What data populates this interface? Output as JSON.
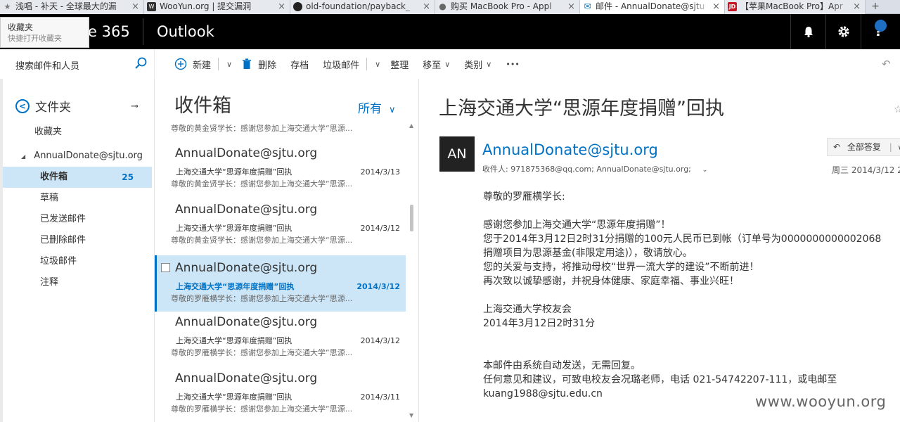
{
  "browser": {
    "tabs": [
      {
        "title": "浅唱 - 补天 - 全球最大的漏",
        "icon": "star-icon",
        "active": false
      },
      {
        "title": "WooYun.org | 提交漏洞",
        "icon": "wooyun-icon",
        "active": false
      },
      {
        "title": "old-foundation/payback_",
        "icon": "github-icon",
        "active": false
      },
      {
        "title": "购买 MacBook Pro - Appl",
        "icon": "apple-icon",
        "active": false
      },
      {
        "title": "邮件 - AnnualDonate@sjtu",
        "icon": "mail-icon",
        "active": true
      },
      {
        "title": "【苹果MacBook Pro】Apr",
        "icon": "jd-icon",
        "active": false
      }
    ],
    "jd_badge": "JD"
  },
  "favorites_popup": {
    "title": "收藏夹",
    "subtitle": "快捷打开收藏夹"
  },
  "suite": {
    "brand": "e 365",
    "app": "Outlook"
  },
  "search": {
    "placeholder": "搜索邮件和人员"
  },
  "commands": {
    "new": "新建",
    "delete": "删除",
    "archive": "存档",
    "junk": "垃圾邮件",
    "sweep": "整理",
    "move": "移至",
    "categories": "类别",
    "more": "•••"
  },
  "folders": {
    "header": "文件夹",
    "favorites": "收藏夹",
    "account": "AnnualDonate@sjtu.org",
    "items": [
      {
        "label": "收件箱",
        "count": "25",
        "selected": true
      },
      {
        "label": "草稿",
        "count": "",
        "selected": false
      },
      {
        "label": "已发送邮件",
        "count": "",
        "selected": false
      },
      {
        "label": "已删除邮件",
        "count": "",
        "selected": false
      },
      {
        "label": "垃圾邮件",
        "count": "",
        "selected": false
      },
      {
        "label": "注释",
        "count": "",
        "selected": false
      }
    ]
  },
  "list": {
    "title": "收件箱",
    "filter": "所有",
    "top_preview": "尊敬的黄金贤学长：感谢您参加上海交通大学“思源...",
    "messages": [
      {
        "sender": "AnnualDonate@sjtu.org",
        "subject": "上海交通大学“思源年度捐赠”回执",
        "date": "2014/3/13",
        "preview": "尊敬的黄金贤学长：感谢您参加上海交通大学“思源...",
        "selected": false
      },
      {
        "sender": "AnnualDonate@sjtu.org",
        "subject": "上海交通大学“思源年度捐赠”回执",
        "date": "2014/3/12",
        "preview": "尊敬的黄金贤学长：感谢您参加上海交通大学“思源...",
        "selected": false
      },
      {
        "sender": "AnnualDonate@sjtu.org",
        "subject": "上海交通大学“思源年度捐赠”回执",
        "date": "2014/3/12",
        "preview": "尊敬的罗雁横学长：感谢您参加上海交通大学“思源...",
        "selected": true
      },
      {
        "sender": "AnnualDonate@sjtu.org",
        "subject": "上海交通大学“思源年度捐赠”回执",
        "date": "2014/3/12",
        "preview": "尊敬的罗雁横学长：感谢您参加上海交通大学“思源...",
        "selected": false
      },
      {
        "sender": "AnnualDonate@sjtu.org",
        "subject": "上海交通大学“思源年度捐赠”回执",
        "date": "2014/3/11",
        "preview": "尊敬的罗雁横学长：感谢您参加上海交通大学“思源...",
        "selected": false
      }
    ]
  },
  "reading": {
    "subject": "上海交通大学“思源年度捐赠”回执",
    "avatar": "AN",
    "from": "AnnualDonate@sjtu.org",
    "to": "收件人: 971875368@qq.com; AnnualDonate@sjtu.org;",
    "reply_all": "全部答复",
    "date": "周三 2014/3/12 2",
    "body": {
      "greeting": "尊敬的罗雁横学长:",
      "line1": "感谢您参加上海交通大学“思源年度捐赠”！",
      "line2": "您于2014年3月12日2时31分捐赠的100元人民币已到帐（订单号为0000000000002068",
      "line3": "捐赠项目为思源基金(非限定用途)），敬请放心。",
      "line4": "您的关爱与支持，将推动母校“世界一流大学的建设”不断前进！",
      "line5": "再次致以诚挚感谢，并祝身体健康、家庭幸福、事业兴旺！",
      "sign1": "上海交通大学校友会",
      "sign2": "2014年3月12日2时31分",
      "note1": "本邮件由系统自动发送，无需回复。",
      "note2": "任何意见和建议，可致电校友会况璐老师，电话 021-54742207-111，或电邮至",
      "note3": "kuang1988@sjtu.edu.cn"
    }
  },
  "watermark": "www.wooyun.org",
  "colors": {
    "accent": "#0072c6",
    "selection": "#cde6f7",
    "suitebar": "#000000"
  }
}
